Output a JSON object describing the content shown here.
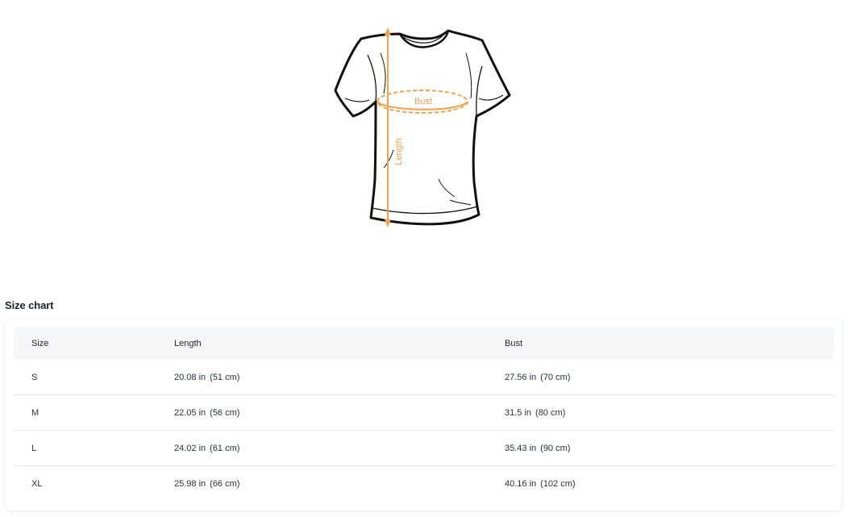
{
  "illustration": {
    "bust_label": "Bust",
    "length_label": "Length",
    "accent_color": "#f5a04a"
  },
  "size_chart": {
    "title": "Size chart",
    "headers": [
      "Size",
      "Length",
      "Bust"
    ],
    "rows": [
      {
        "size": "S",
        "length_in": "20.08 in",
        "length_cm": "(51 cm)",
        "bust_in": "27.56 in",
        "bust_cm": "(70 cm)"
      },
      {
        "size": "M",
        "length_in": "22.05 in",
        "length_cm": "(56 cm)",
        "bust_in": "31.5 in",
        "bust_cm": "(80 cm)"
      },
      {
        "size": "L",
        "length_in": "24.02 in",
        "length_cm": "(61 cm)",
        "bust_in": "35.43 in",
        "bust_cm": "(90 cm)"
      },
      {
        "size": "XL",
        "length_in": "25.98 in",
        "length_cm": "(66 cm)",
        "bust_in": "40.16 in",
        "bust_cm": "(102 cm)"
      }
    ]
  }
}
